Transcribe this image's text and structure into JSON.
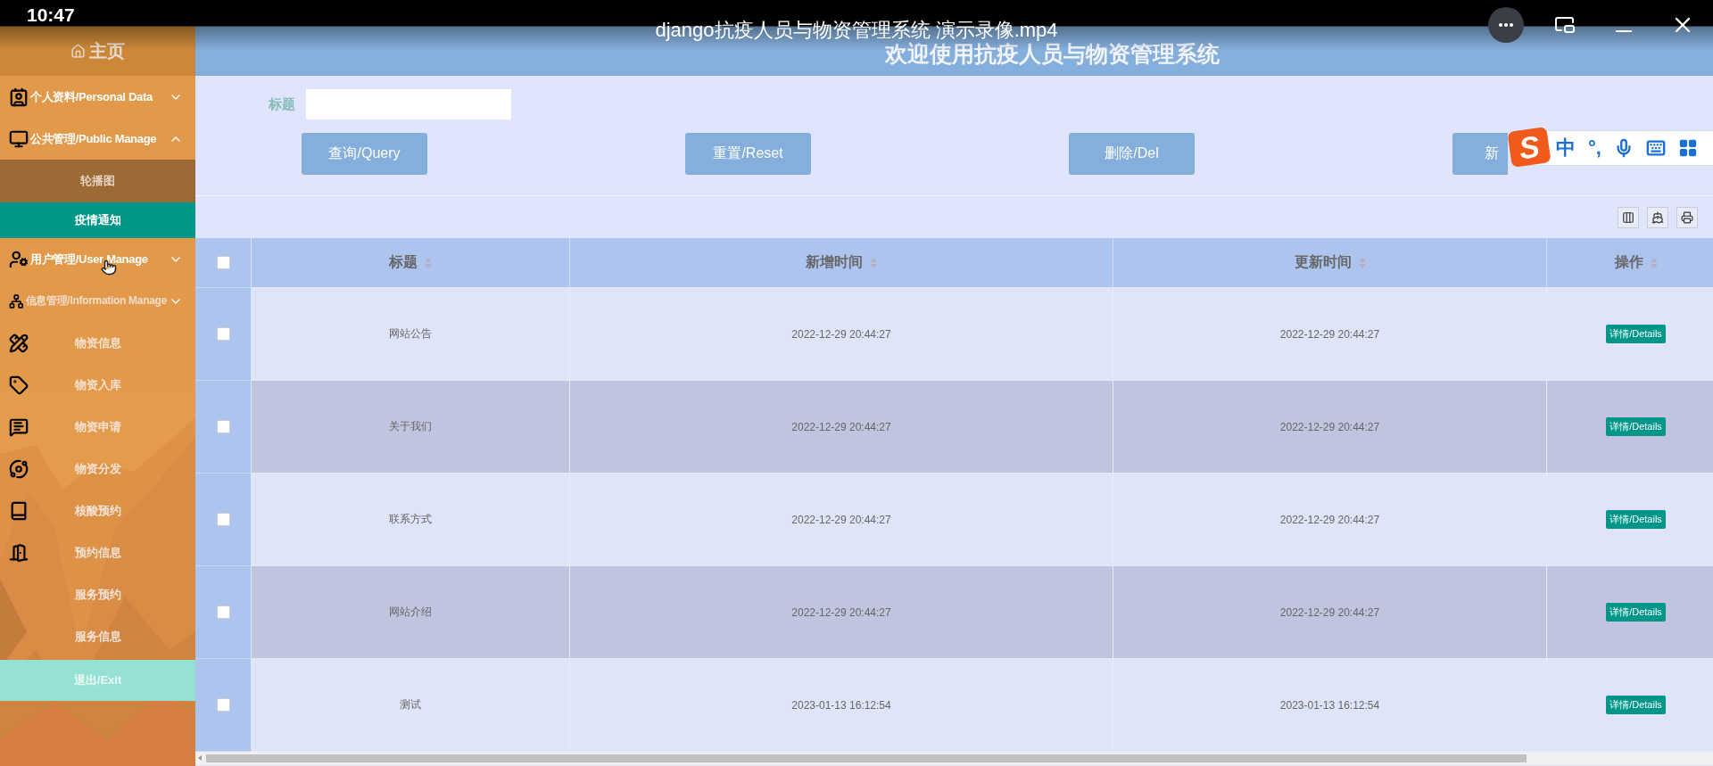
{
  "video_player": {
    "time": "10:47",
    "title": "django抗疫人员与物资管理系统 演示录像.mp4"
  },
  "header": {
    "title": "欢迎使用抗疫人员与物资管理系统"
  },
  "sidebar": {
    "home": "主页",
    "items": [
      {
        "kind": "group",
        "label": "个人资料/Personal Data",
        "expanded": false
      },
      {
        "kind": "group",
        "label": "公共管理/Public Manage",
        "expanded": true,
        "children": [
          {
            "label": "轮播图",
            "selected": false
          },
          {
            "label": "疫情通知",
            "selected": true
          }
        ]
      },
      {
        "kind": "group",
        "label": "用户管理/User Manage",
        "expanded": false
      },
      {
        "kind": "group",
        "label": "信息管理/Information Manage",
        "expanded": false
      },
      {
        "kind": "link",
        "label": "物资信息",
        "selected": false
      },
      {
        "kind": "link",
        "label": "物资入库",
        "selected": false
      },
      {
        "kind": "link",
        "label": "物资申请",
        "selected": false
      },
      {
        "kind": "link",
        "label": "物资分发",
        "selected": false
      },
      {
        "kind": "link",
        "label": "核酸预约",
        "selected": false
      },
      {
        "kind": "link",
        "label": "预约信息",
        "selected": false
      },
      {
        "kind": "link",
        "label": "服务预约",
        "selected": false
      },
      {
        "kind": "link",
        "label": "服务信息",
        "selected": false
      }
    ],
    "exit": "退出/Exit"
  },
  "search": {
    "label": "标题",
    "buttons": [
      "查询/Query",
      "重置/Reset",
      "删除/Del",
      "新"
    ]
  },
  "ime_toolbar": {
    "logo": "S",
    "mode": "中",
    "punctuation": "°,"
  },
  "table": {
    "select_all": {
      "checked": false
    },
    "columns": [
      "标题",
      "新增时间",
      "更新时间",
      "操作"
    ],
    "rows": [
      {
        "checked": false,
        "title": "网站公告",
        "created": "2022-12-29 20:44:27",
        "updated": "2022-12-29 20:44:27",
        "action": "详情/Details"
      },
      {
        "checked": false,
        "title": "关于我们",
        "created": "2022-12-29 20:44:27",
        "updated": "2022-12-29 20:44:27",
        "action": "详情/Details"
      },
      {
        "checked": false,
        "title": "联系方式",
        "created": "2022-12-29 20:44:27",
        "updated": "2022-12-29 20:44:27",
        "action": "详情/Details"
      },
      {
        "checked": false,
        "title": "网站介绍",
        "created": "2022-12-29 20:44:27",
        "updated": "2022-12-29 20:44:27",
        "action": "详情/Details"
      },
      {
        "checked": false,
        "title": "测试",
        "created": "2023-01-13 16:12:54",
        "updated": "2023-01-13 16:12:54",
        "action": "详情/Details"
      }
    ]
  }
}
